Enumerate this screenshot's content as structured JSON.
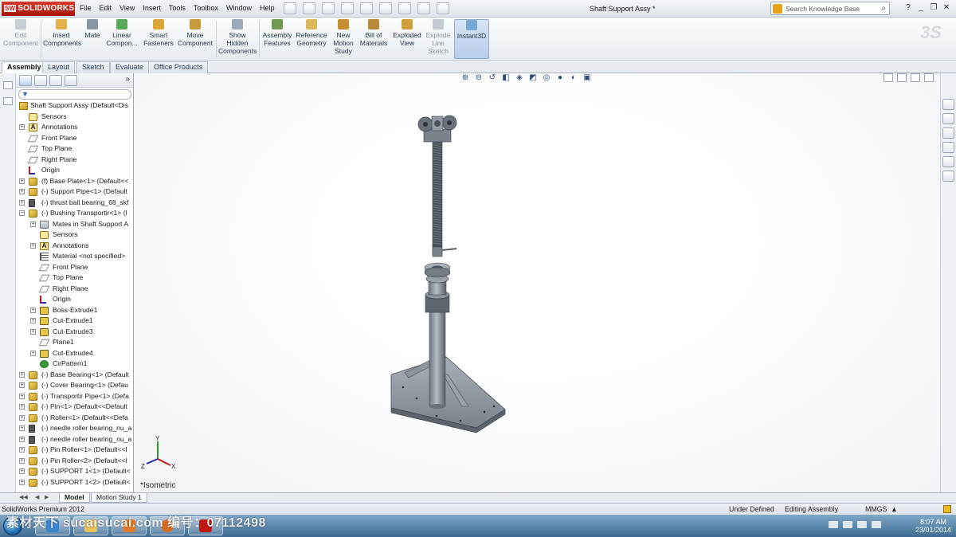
{
  "app": {
    "logo_text": "SOLIDWORKS",
    "logo_badge": "SW",
    "menu": [
      "File",
      "Edit",
      "View",
      "Insert",
      "Tools",
      "Toolbox",
      "Window",
      "Help"
    ],
    "document_title": "Shaft Support Assy *",
    "search_placeholder": "Search Knowledge Base",
    "window_buttons": [
      "?",
      "_",
      "❐",
      "✕"
    ]
  },
  "commands": [
    {
      "label": "Edit\nComponent",
      "icon": "edit-component-icon",
      "disabled": true
    },
    {
      "label": "Insert\nComponents",
      "icon": "insert-components-icon",
      "disabled": false
    },
    {
      "label": "Mate",
      "icon": "mate-icon",
      "disabled": false
    },
    {
      "label": "Linear\nCompon...",
      "icon": "linear-pattern-icon",
      "disabled": false
    },
    {
      "label": "Smart\nFasteners",
      "icon": "smart-fasteners-icon",
      "disabled": false
    },
    {
      "label": "Move\nComponent",
      "icon": "move-component-icon",
      "disabled": false
    },
    {
      "label": "Show\nHidden\nComponents",
      "icon": "show-hidden-icon",
      "disabled": false
    },
    {
      "label": "Assembly\nFeatures",
      "icon": "assembly-features-icon",
      "disabled": false
    },
    {
      "label": "Reference\nGeometry",
      "icon": "reference-geometry-icon",
      "disabled": false
    },
    {
      "label": "New\nMotion\nStudy",
      "icon": "motion-study-icon",
      "disabled": false
    },
    {
      "label": "Bill of\nMaterials",
      "icon": "bill-of-materials-icon",
      "disabled": false
    },
    {
      "label": "Exploded\nView",
      "icon": "exploded-view-icon",
      "disabled": false
    },
    {
      "label": "Explode\nLine\nSketch",
      "icon": "explode-line-sketch-icon",
      "disabled": true
    },
    {
      "label": "Instant3D",
      "icon": "instant3d-icon",
      "disabled": false,
      "active": true
    }
  ],
  "tabs": [
    "Assembly",
    "Layout",
    "Sketch",
    "Evaluate",
    "Office Products"
  ],
  "active_tab": "Assembly",
  "tree": {
    "root": "Shaft Support Assy  (Default<Dis",
    "items": [
      {
        "label": "Sensors",
        "icon": "sensor-icon",
        "indent": 0,
        "expander": ""
      },
      {
        "label": "Annotations",
        "icon": "annotation-icon",
        "indent": 0,
        "expander": "+"
      },
      {
        "label": "Front Plane",
        "icon": "plane-icon",
        "indent": 0,
        "expander": ""
      },
      {
        "label": "Top Plane",
        "icon": "plane-icon",
        "indent": 0,
        "expander": ""
      },
      {
        "label": "Right Plane",
        "icon": "plane-icon",
        "indent": 0,
        "expander": ""
      },
      {
        "label": "Origin",
        "icon": "origin-icon",
        "indent": 0,
        "expander": ""
      },
      {
        "label": "(f) Base Plate<1> (Default<<",
        "icon": "component-icon",
        "indent": 0,
        "expander": "+"
      },
      {
        "label": "(-) Support Pipe<1> (Default",
        "icon": "component-icon",
        "indent": 0,
        "expander": "+"
      },
      {
        "label": "(-) thrust ball bearing_68_skf",
        "icon": "bearing-icon",
        "indent": 0,
        "expander": "+"
      },
      {
        "label": "(-) Bushing Transportir<1> (I",
        "icon": "component-icon",
        "indent": 0,
        "expander": "−"
      },
      {
        "label": "Mates in Shaft Support A",
        "icon": "mates-icon",
        "indent": 1,
        "expander": "+"
      },
      {
        "label": "Sensors",
        "icon": "sensor-icon",
        "indent": 1,
        "expander": ""
      },
      {
        "label": "Annotations",
        "icon": "annotation-icon",
        "indent": 1,
        "expander": "+"
      },
      {
        "label": "Material <not specified>",
        "icon": "material-icon",
        "indent": 1,
        "expander": ""
      },
      {
        "label": "Front Plane",
        "icon": "plane-icon",
        "indent": 1,
        "expander": ""
      },
      {
        "label": "Top Plane",
        "icon": "plane-icon",
        "indent": 1,
        "expander": ""
      },
      {
        "label": "Right Plane",
        "icon": "plane-icon",
        "indent": 1,
        "expander": ""
      },
      {
        "label": "Origin",
        "icon": "origin-icon",
        "indent": 1,
        "expander": ""
      },
      {
        "label": "Boss-Extrude1",
        "icon": "feature-icon",
        "indent": 1,
        "expander": "+"
      },
      {
        "label": "Cut-Extrude1",
        "icon": "feature-icon",
        "indent": 1,
        "expander": "+"
      },
      {
        "label": "Cut-Extrude3",
        "icon": "feature-icon",
        "indent": 1,
        "expander": "+"
      },
      {
        "label": "Plane1",
        "icon": "plane-icon",
        "indent": 1,
        "expander": ""
      },
      {
        "label": "Cut-Extrude4",
        "icon": "feature-icon",
        "indent": 1,
        "expander": "+"
      },
      {
        "label": "CirPattern1",
        "icon": "pattern-icon",
        "indent": 1,
        "expander": ""
      },
      {
        "label": "(-) Base Bearing<1> (Default",
        "icon": "component-icon",
        "indent": 0,
        "expander": "+"
      },
      {
        "label": "(-) Cover Bearing<1> (Defau",
        "icon": "component-icon",
        "indent": 0,
        "expander": "+"
      },
      {
        "label": "(-) Transportir Pipe<1> (Defa",
        "icon": "component-icon",
        "indent": 0,
        "expander": "+"
      },
      {
        "label": "(-) Pin<1> (Default<<Default",
        "icon": "component-icon",
        "indent": 0,
        "expander": "+"
      },
      {
        "label": "(-) Roller<1> (Default<<Defa",
        "icon": "component-icon",
        "indent": 0,
        "expander": "+"
      },
      {
        "label": "(-) needle roller bearing_nu_a",
        "icon": "bearing-icon",
        "indent": 0,
        "expander": "+"
      },
      {
        "label": "(-) needle roller bearing_nu_a",
        "icon": "bearing-icon",
        "indent": 0,
        "expander": "+"
      },
      {
        "label": "(-) Pin Roller<1> (Default<<I",
        "icon": "component-icon",
        "indent": 0,
        "expander": "+"
      },
      {
        "label": "(-) Pin Roller<2> (Default<<I",
        "icon": "component-icon",
        "indent": 0,
        "expander": "+"
      },
      {
        "label": "(-) SUPPORT 1<1> (Default<",
        "icon": "component-icon",
        "indent": 0,
        "expander": "+"
      },
      {
        "label": "(-) SUPPORT 1<2> (Default<",
        "icon": "component-icon",
        "indent": 0,
        "expander": "+"
      }
    ]
  },
  "bottom_tabs": [
    "Model",
    "Motion Study 1"
  ],
  "viewport": {
    "view_label": "*Isometric",
    "triad": {
      "x": "X",
      "y": "Y",
      "z": "Z"
    }
  },
  "status": {
    "product": "SolidWorks Premium 2012",
    "state": "Under Defined",
    "mode": "Editing Assembly",
    "units": "MMGS",
    "units_arrow": "▲"
  },
  "taskbar": {
    "watermark": "素材天下 sucaisucai.com   编号：07112498",
    "time": "8:07 AM",
    "date": "23/01/2014"
  },
  "colors": {
    "accent": "#c0180d",
    "model_grey": "#8d949e",
    "taskbar_blue": "#3f6b93"
  }
}
